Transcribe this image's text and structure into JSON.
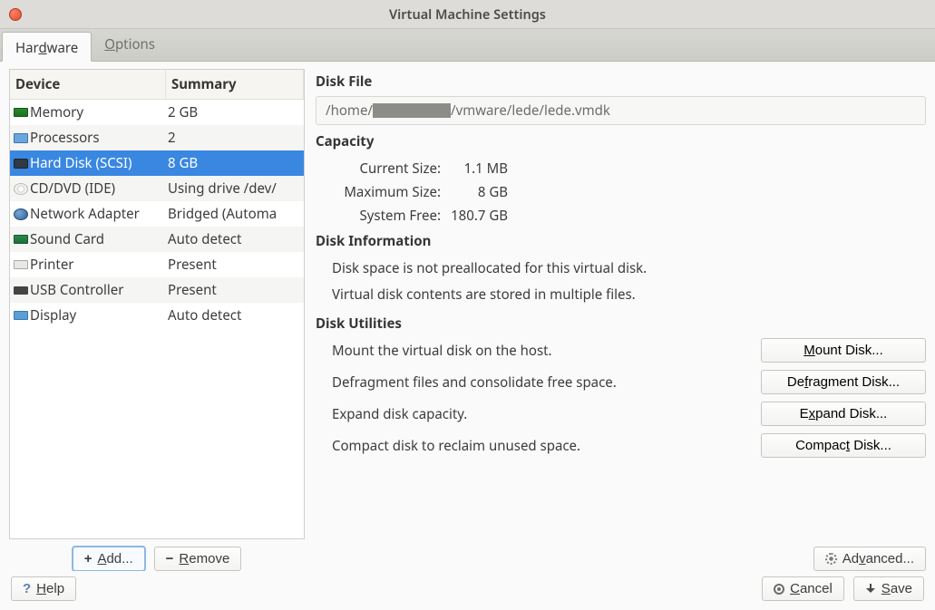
{
  "window": {
    "title": "Virtual Machine Settings"
  },
  "tabs": {
    "hardware_pre": "Har",
    "hardware_key": "d",
    "hardware_post": "ware",
    "options_key": "O",
    "options_post": "ptions"
  },
  "device_header": {
    "device": "Device",
    "summary": "Summary"
  },
  "devices": [
    {
      "name": "Memory",
      "summary": "2 GB",
      "icon": "memory"
    },
    {
      "name": "Processors",
      "summary": "2",
      "icon": "cpu"
    },
    {
      "name": "Hard Disk (SCSI)",
      "summary": "8 GB",
      "icon": "hdd",
      "selected": true
    },
    {
      "name": "CD/DVD (IDE)",
      "summary": "Using drive /dev/",
      "icon": "cd"
    },
    {
      "name": "Network Adapter",
      "summary": "Bridged (Automa",
      "icon": "net"
    },
    {
      "name": "Sound Card",
      "summary": "Auto detect",
      "icon": "sound"
    },
    {
      "name": "Printer",
      "summary": "Present",
      "icon": "printer"
    },
    {
      "name": "USB Controller",
      "summary": "Present",
      "icon": "usb"
    },
    {
      "name": "Display",
      "summary": "Auto detect",
      "icon": "display"
    }
  ],
  "device_buttons": {
    "add_key": "A",
    "add_post": "dd...",
    "remove_key": "R",
    "remove_post": "emove"
  },
  "detail": {
    "disk_file_title": "Disk File",
    "disk_file_pre": "/home/",
    "disk_file_post": "/vmware/lede/lede.vmdk",
    "capacity_title": "Capacity",
    "capacity": {
      "current_label": "Current Size:",
      "current_val": "1.1 MB",
      "max_label": "Maximum Size:",
      "max_val": "8 GB",
      "free_label": "System Free:",
      "free_val": "180.7 GB"
    },
    "disk_info_title": "Disk Information",
    "disk_info_1": "Disk space is not preallocated for this virtual disk.",
    "disk_info_2": "Virtual disk contents are stored in multiple files.",
    "disk_util_title": "Disk Utilities",
    "utilities": {
      "mount_desc": "Mount the virtual disk on the host.",
      "mount_btn_key": "M",
      "mount_btn_post": "ount Disk...",
      "defrag_desc": "Defragment files and consolidate free space.",
      "defrag_btn_pre": "De",
      "defrag_btn_key": "f",
      "defrag_btn_post": "ragment Disk...",
      "expand_desc": "Expand disk capacity.",
      "expand_btn_pre": "E",
      "expand_btn_key": "x",
      "expand_btn_post": "pand Disk...",
      "compact_desc": "Compact disk to reclaim unused space.",
      "compact_btn_pre": "Compac",
      "compact_btn_key": "t",
      "compact_btn_post": " Disk..."
    },
    "advanced_pre": "Ad",
    "advanced_key": "v",
    "advanced_post": "anced..."
  },
  "bottom": {
    "help_key": "H",
    "help_post": "elp",
    "cancel_key": "C",
    "cancel_post": "ancel",
    "save_key": "S",
    "save_post": "ave"
  }
}
